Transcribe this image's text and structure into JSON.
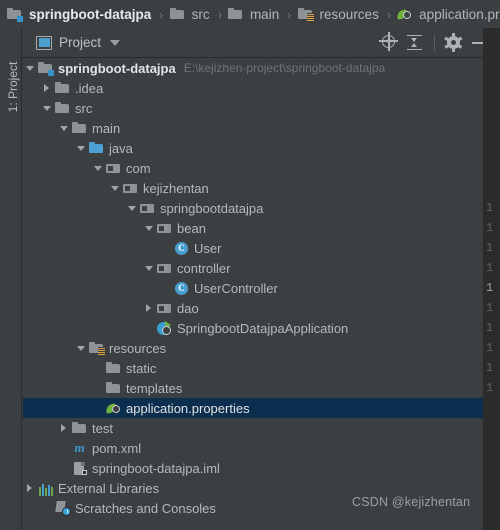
{
  "breadcrumb": {
    "separator": "›",
    "items": [
      {
        "label": "springboot-datajpa",
        "icon": "module-folder-icon"
      },
      {
        "label": "src",
        "icon": "folder-icon"
      },
      {
        "label": "main",
        "icon": "folder-icon"
      },
      {
        "label": "resources",
        "icon": "resources-folder-icon"
      },
      {
        "label": "application.properties",
        "icon": "spring-properties-icon"
      }
    ]
  },
  "tool_window": {
    "title": "Project",
    "title_icon": "project-window-icon",
    "dropdown_icon": "chevron-down-icon",
    "vertical_tab": "1: Project",
    "actions": [
      {
        "name": "select-opened-file",
        "icon": "locate-target-icon"
      },
      {
        "name": "collapse-all",
        "icon": "collapse-all-icon"
      },
      {
        "name": "settings",
        "icon": "gear-icon"
      },
      {
        "name": "hide",
        "icon": "minimize-icon"
      }
    ]
  },
  "tree": {
    "rows": [
      {
        "label": "springboot-datajpa",
        "hint": "E:\\kejizhen-project\\springboot-datajpa",
        "indent": 0,
        "arrow": "open",
        "icon": "module-folder-icon",
        "bold": true,
        "selected": false
      },
      {
        "label": ".idea",
        "hint": "",
        "indent": 1,
        "arrow": "closed",
        "icon": "folder-icon",
        "bold": false,
        "selected": false
      },
      {
        "label": "src",
        "hint": "",
        "indent": 1,
        "arrow": "open",
        "icon": "folder-icon",
        "bold": false,
        "selected": false
      },
      {
        "label": "main",
        "hint": "",
        "indent": 2,
        "arrow": "open",
        "icon": "folder-icon",
        "bold": false,
        "selected": false
      },
      {
        "label": "java",
        "hint": "",
        "indent": 3,
        "arrow": "open",
        "icon": "source-root-icon",
        "bold": false,
        "selected": false
      },
      {
        "label": "com",
        "hint": "",
        "indent": 4,
        "arrow": "open",
        "icon": "package-icon",
        "bold": false,
        "selected": false
      },
      {
        "label": "kejizhentan",
        "hint": "",
        "indent": 5,
        "arrow": "open",
        "icon": "package-icon",
        "bold": false,
        "selected": false
      },
      {
        "label": "springbootdatajpa",
        "hint": "",
        "indent": 6,
        "arrow": "open",
        "icon": "package-icon",
        "bold": false,
        "selected": false
      },
      {
        "label": "bean",
        "hint": "",
        "indent": 7,
        "arrow": "open",
        "icon": "package-icon",
        "bold": false,
        "selected": false
      },
      {
        "label": "User",
        "hint": "",
        "indent": 8,
        "arrow": "none",
        "icon": "java-class-icon",
        "bold": false,
        "selected": false
      },
      {
        "label": "controller",
        "hint": "",
        "indent": 7,
        "arrow": "open",
        "icon": "package-icon",
        "bold": false,
        "selected": false
      },
      {
        "label": "UserController",
        "hint": "",
        "indent": 8,
        "arrow": "none",
        "icon": "java-class-icon",
        "bold": false,
        "selected": false
      },
      {
        "label": "dao",
        "hint": "",
        "indent": 7,
        "arrow": "closed",
        "icon": "package-icon",
        "bold": false,
        "selected": false
      },
      {
        "label": "SpringbootDatajpaApplication",
        "hint": "",
        "indent": 7,
        "arrow": "none",
        "icon": "spring-run-class-icon",
        "bold": false,
        "selected": false
      },
      {
        "label": "resources",
        "hint": "",
        "indent": 3,
        "arrow": "open",
        "icon": "resources-folder-icon",
        "bold": false,
        "selected": false
      },
      {
        "label": "static",
        "hint": "",
        "indent": 4,
        "arrow": "none",
        "icon": "folder-icon",
        "bold": false,
        "selected": false
      },
      {
        "label": "templates",
        "hint": "",
        "indent": 4,
        "arrow": "none",
        "icon": "folder-icon",
        "bold": false,
        "selected": false
      },
      {
        "label": "application.properties",
        "hint": "",
        "indent": 4,
        "arrow": "none",
        "icon": "spring-properties-icon",
        "bold": false,
        "selected": true
      },
      {
        "label": "test",
        "hint": "",
        "indent": 2,
        "arrow": "closed",
        "icon": "folder-icon",
        "bold": false,
        "selected": false
      },
      {
        "label": "pom.xml",
        "hint": "",
        "indent": 2,
        "arrow": "none",
        "icon": "maven-icon",
        "bold": false,
        "selected": false
      },
      {
        "label": "springboot-datajpa.iml",
        "hint": "",
        "indent": 2,
        "arrow": "none",
        "icon": "iml-file-icon",
        "bold": false,
        "selected": false
      },
      {
        "label": "External Libraries",
        "hint": "",
        "indent": 0,
        "arrow": "closed",
        "icon": "external-libraries-icon",
        "bold": false,
        "selected": false
      },
      {
        "label": "Scratches and Consoles",
        "hint": "",
        "indent": 1,
        "arrow": "none",
        "icon": "scratches-icon",
        "bold": false,
        "selected": false
      }
    ]
  },
  "editor": {
    "line_numbers": [
      "1",
      "1",
      "1",
      "1",
      "1",
      "1",
      "1",
      "1",
      "1",
      "1"
    ],
    "current_line_index": 4
  },
  "watermark": "CSDN @kejizhentan",
  "colors": {
    "background": "#3c3f41",
    "editor_background": "#2b2b2b",
    "selection": "#0d2f4f",
    "accent_blue": "#4a9dd0",
    "spring_green": "#6db33f"
  }
}
